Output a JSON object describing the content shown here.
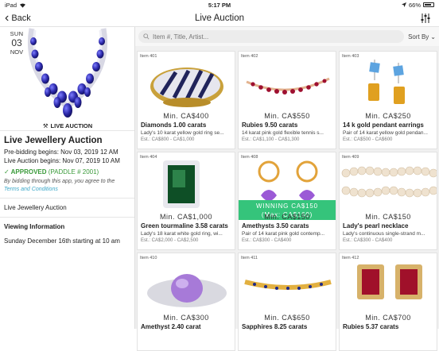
{
  "status": {
    "device": "iPad",
    "time": "5:17 PM",
    "battery": "66%"
  },
  "nav": {
    "back_label": "Back",
    "title": "Live Auction"
  },
  "search": {
    "placeholder": "Item #, Title, Artist...",
    "sort_label": "Sort By"
  },
  "sidebar": {
    "date": {
      "dow": "SUN",
      "day": "03",
      "month": "NOV"
    },
    "hero_caption": "LIVE AUCTION",
    "title": "Live Jewellery Auction",
    "prebid": "Pre-bidding begins: Nov 03, 2019 12 AM",
    "live": "Live Auction begins: Nov 07, 2019 10 AM",
    "approved": "✓ APPROVED",
    "paddle": "(PADDLE # 2001)",
    "note_prefix": "By bidding through this app, you agree to the",
    "terms_link": "Terms and Conditions",
    "row_auction": "Live Jewellery Auction",
    "row_viewing": "Viewing Information",
    "row_date": "Sunday December 16th starting at 10 am"
  },
  "lots": [
    {
      "lot": "Item 401",
      "min": "Min. CA$400",
      "title": "Diamonds 1.00 carats",
      "desc": "Lady's 10 karat yellow gold ring se...",
      "est": "Est.: CA$800 - CA$1,000"
    },
    {
      "lot": "Item 402",
      "min": "Min. CA$550",
      "title": "Rubies 9.50 carats",
      "desc": "14 karat pink gold flexible tennis s...",
      "est": "Est.: CA$1,100 - CA$1,300"
    },
    {
      "lot": "Item 403",
      "min": "Min. CA$250",
      "title": "14 k gold pendant earrings",
      "desc": "Pair of 14 karat yellow gold pendan...",
      "est": "Est.: CA$500 - CA$600"
    },
    {
      "lot": "Item 404",
      "min": "Min. CA$1,000",
      "title": "Green tourmaline 3.58 carats",
      "desc": "Lady's 18 karat white gold ring, wi...",
      "est": "Est.: CA$2,000 - CA$2,500"
    },
    {
      "lot": "Item 408",
      "min": "Min. CA$150",
      "title": "Amethysts 3.50 carats",
      "desc": "Pair of 14 karat pink gold contemp...",
      "est": "Est.: CA$300 - CA$400",
      "winning": "WINNING CA$150",
      "winning_max": "(Max: CA$160)"
    },
    {
      "lot": "Item 409",
      "min": "Min. CA$150",
      "title": "Lady's pearl necklace",
      "desc": "Lady's continuous single-strand m...",
      "est": "Est.: CA$300 - CA$400"
    },
    {
      "lot": "Item 410",
      "min": "Min. CA$300",
      "title": "Amethyst 2.40 carat",
      "desc": "",
      "est": ""
    },
    {
      "lot": "Item 411",
      "min": "Min. CA$650",
      "title": "Sapphires 8.25 carats",
      "desc": "",
      "est": ""
    },
    {
      "lot": "Item 412",
      "min": "Min. CA$700",
      "title": "Rubies 5.37 carats",
      "desc": "",
      "est": ""
    }
  ],
  "colors": {
    "approved": "#3a9a3a",
    "winning": "#35c47b",
    "link": "#3aa7c8"
  }
}
